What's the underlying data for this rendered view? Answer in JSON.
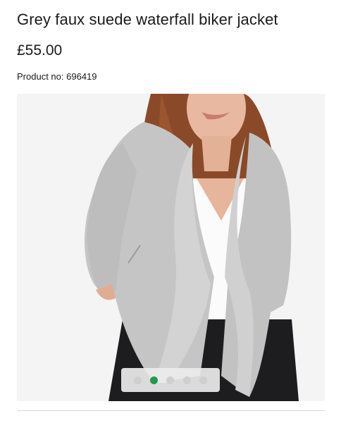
{
  "product": {
    "title": "Grey faux suede waterfall biker jacket",
    "price": "£55.00",
    "product_no_label": "Product no:",
    "product_no_value": "696419"
  },
  "gallery": {
    "image_icon": "product-photo",
    "dots": 5,
    "active_index": 1,
    "active_color": "#1f9a4f",
    "inactive_color": "#cfcfcf"
  }
}
